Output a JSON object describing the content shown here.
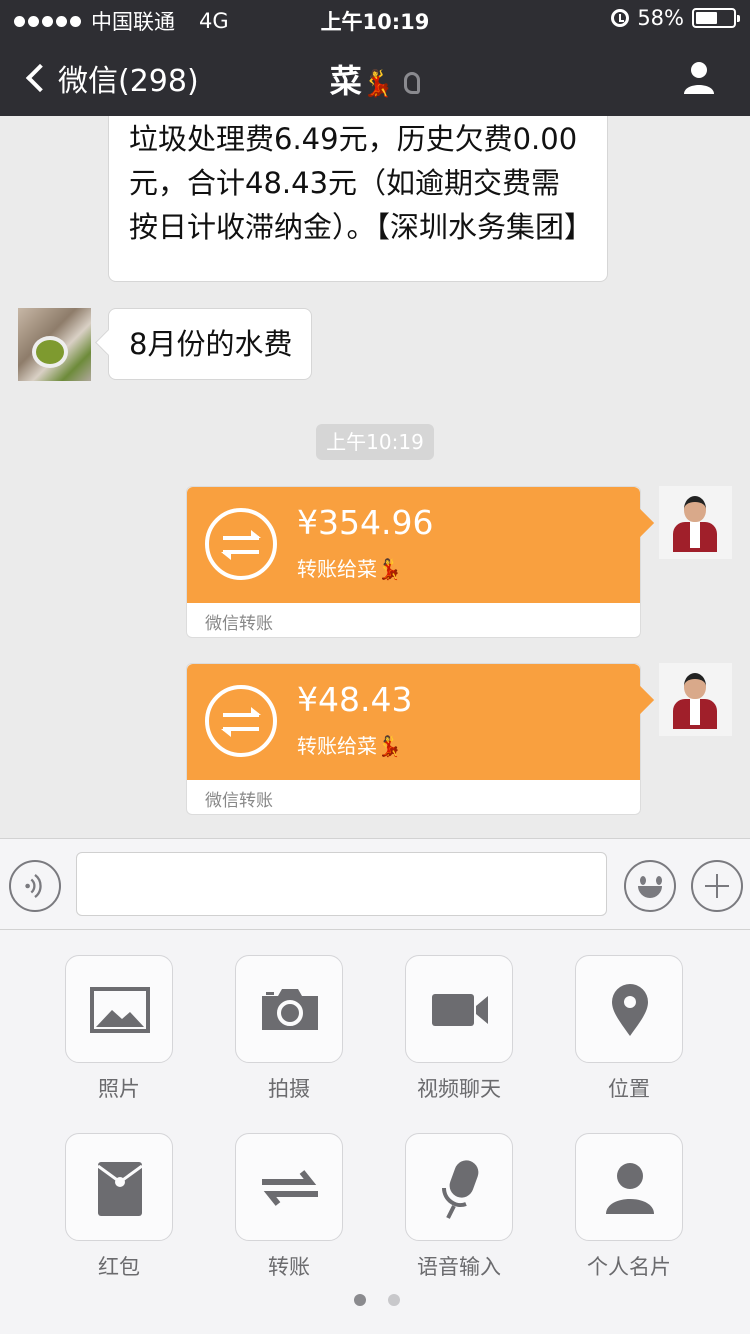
{
  "status_bar": {
    "carrier": "中国联通",
    "network": "4G",
    "time": "上午10:19",
    "battery_text": "58%",
    "battery_level": 0.58,
    "signal_dots": 5
  },
  "nav": {
    "back_label": "微信(298)",
    "title": "菜",
    "title_emoji": "💃"
  },
  "messages": {
    "partial_text": "垃圾处理费6.49元，历史欠费0.00元，合计48.43元（如逾期交费需按日计收滞纳金）。【深圳水务集团】",
    "incoming_text": "8月份的水费",
    "timestamp": "上午10:19",
    "transfers": [
      {
        "amount": "¥354.96",
        "note": "转账给菜💃",
        "footer": "微信转账"
      },
      {
        "amount": "¥48.43",
        "note": "转账给菜💃",
        "footer": "微信转账"
      }
    ]
  },
  "panel": {
    "items": [
      {
        "label": "照片",
        "icon": "photo-icon"
      },
      {
        "label": "拍摄",
        "icon": "camera-icon"
      },
      {
        "label": "视频聊天",
        "icon": "video-call-icon"
      },
      {
        "label": "位置",
        "icon": "location-icon"
      },
      {
        "label": "红包",
        "icon": "red-packet-icon"
      },
      {
        "label": "转账",
        "icon": "transfer-icon"
      },
      {
        "label": "语音输入",
        "icon": "microphone-icon"
      },
      {
        "label": "个人名片",
        "icon": "contact-card-icon"
      }
    ],
    "page_count": 2,
    "active_page": 1
  },
  "colors": {
    "nav_bg": "#2e2e33",
    "transfer_orange": "#f9a03f",
    "chat_bg": "#ebebeb",
    "icon_gray": "#6c6c70"
  }
}
